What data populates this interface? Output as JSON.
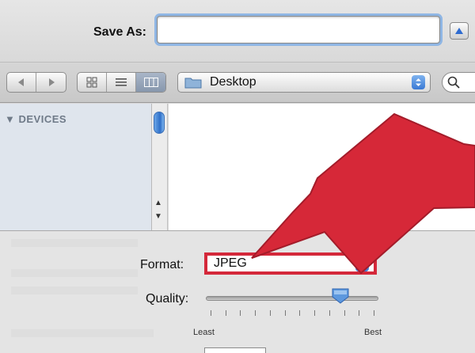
{
  "save_as": {
    "label": "Save As:",
    "value": ""
  },
  "location": {
    "label": "Desktop"
  },
  "sidebar": {
    "header": "DEVICES"
  },
  "format": {
    "label": "Format:",
    "value": "JPEG"
  },
  "quality": {
    "label": "Quality:",
    "min_label": "Least",
    "max_label": "Best",
    "level": 0.78
  },
  "colors": {
    "highlight": "#d4283a",
    "focus_ring": "#8fb6e4",
    "accent": "#3a79d4"
  },
  "icons": [
    "expand-arrow-up-icon",
    "back-arrow-icon",
    "forward-arrow-icon",
    "icon-view-icon",
    "list-view-icon",
    "column-view-icon",
    "folder-icon",
    "updown-chevron-icon",
    "search-icon",
    "disclosure-triangle-icon"
  ]
}
